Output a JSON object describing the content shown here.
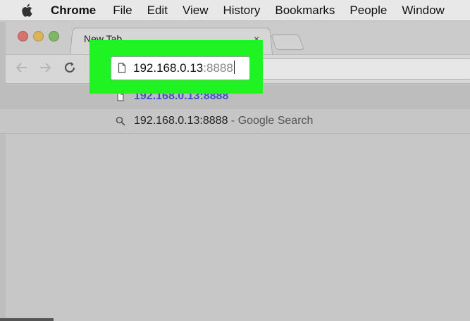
{
  "menubar": {
    "app_name": "Chrome",
    "items": [
      "File",
      "Edit",
      "View",
      "History",
      "Bookmarks",
      "People",
      "Window"
    ]
  },
  "tab": {
    "title": "New Tab",
    "close_glyph": "×"
  },
  "address_bar": {
    "host": "192.168.0.13",
    "port": ":8888"
  },
  "suggestions": [
    {
      "text": "192.168.0.13:8888",
      "suffix": "",
      "icon": "page-icon"
    },
    {
      "text": "192.168.0.13:8888",
      "suffix": " - Google Search",
      "icon": "search-icon"
    }
  ],
  "colors": {
    "highlight": "#1ff321",
    "suggestion_link": "#3d54c7"
  }
}
